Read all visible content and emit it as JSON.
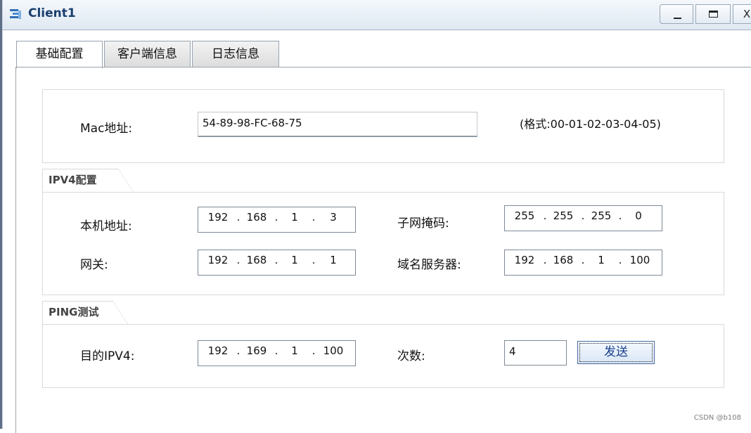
{
  "window": {
    "title": "Client1",
    "controls": {
      "minimize": "_",
      "maximize": "□",
      "close": "X"
    }
  },
  "tabs": [
    {
      "label": "基础配置",
      "active": true
    },
    {
      "label": "客户端信息",
      "active": false
    },
    {
      "label": "日志信息",
      "active": false
    }
  ],
  "mac": {
    "label": "Mac地址:",
    "value": "54-89-98-FC-68-75",
    "hint": "(格式:00-01-02-03-04-05)"
  },
  "ipv4": {
    "group_title": "IPV4配置",
    "host_label": "本机地址:",
    "host": [
      "192",
      "168",
      "1",
      "3"
    ],
    "mask_label": "子网掩码:",
    "mask": [
      "255",
      "255",
      "255",
      "0"
    ],
    "gateway_label": "网关:",
    "gateway": [
      "192",
      "168",
      "1",
      "1"
    ],
    "dns_label": "域名服务器:",
    "dns": [
      "192",
      "168",
      "1",
      "100"
    ]
  },
  "ping": {
    "group_title": "PING测试",
    "target_label": "目的IPV4:",
    "target": [
      "192",
      "169",
      "1",
      "100"
    ],
    "count_label": "次数:",
    "count": "4",
    "send_label": "发送"
  },
  "watermark": "CSDN @b108",
  "colors": {
    "title_text": "#1a3f6f",
    "send_button_text": "#1a3f8f"
  }
}
